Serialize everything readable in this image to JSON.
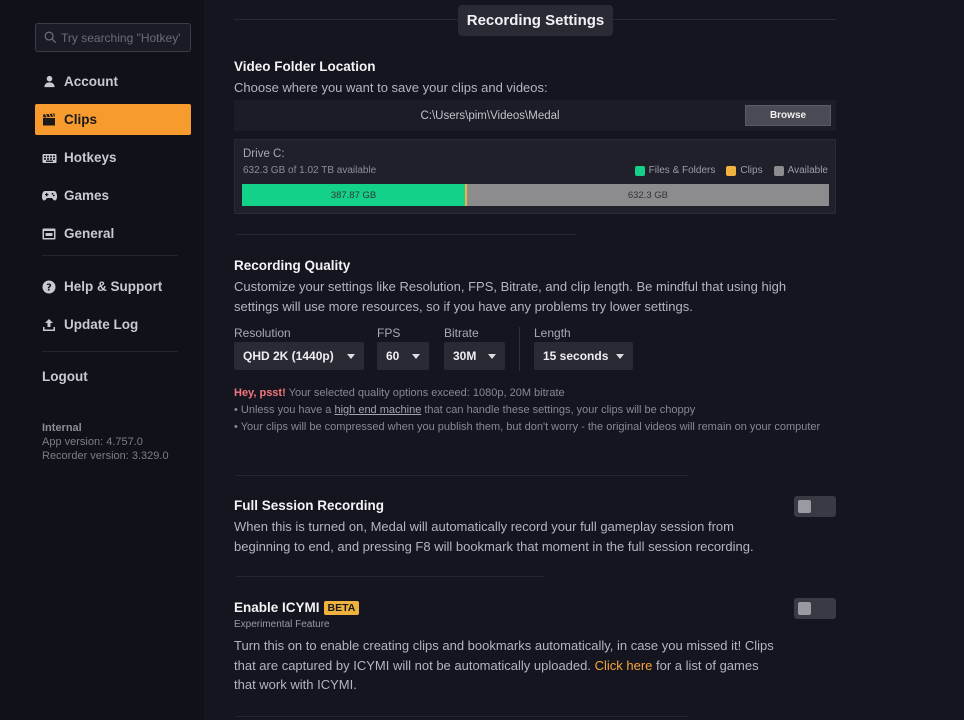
{
  "sidebar": {
    "search_placeholder": "Try searching \"Hotkey\"",
    "items": [
      {
        "label": "Account",
        "icon": "user-icon"
      },
      {
        "label": "Clips",
        "icon": "clapperboard-icon",
        "active": true
      },
      {
        "label": "Hotkeys",
        "icon": "keyboard-icon"
      },
      {
        "label": "Games",
        "icon": "gamepad-icon"
      },
      {
        "label": "General",
        "icon": "window-icon"
      }
    ],
    "support_items": [
      {
        "label": "Help & Support",
        "icon": "help-circle-icon"
      },
      {
        "label": "Update Log",
        "icon": "upload-icon"
      }
    ],
    "logout": "Logout",
    "build": "Internal",
    "app_version": "App version: 4.757.0",
    "recorder_version": "Recorder version: 3.329.0"
  },
  "colors": {
    "accent": "#f89b2e",
    "files": "#14d18a",
    "clips": "#f0b23e",
    "available": "#8c8c8f",
    "warning": "#f4777e"
  },
  "page": {
    "title": "Recording Settings"
  },
  "video_folder": {
    "title": "Video Folder Location",
    "description": "Choose where you want to save your clips and videos:",
    "path": "C:\\Users\\pim\\Videos\\Medal",
    "browse_label": "Browse",
    "drive_label": "Drive C:",
    "drive_summary": "632.3 GB of 1.02 TB available",
    "legend": {
      "files": "Files & Folders",
      "clips": "Clips",
      "available": "Available"
    },
    "files_label": "387.87 GB",
    "available_label": "632.3 GB",
    "files_fraction": 0.38,
    "clips_fraction": 0.003
  },
  "quality": {
    "title": "Recording Quality",
    "description": "Customize your settings like Resolution, FPS, Bitrate, and clip length. Be mindful that using high settings will use more resources, so if you have any problems try lower settings.",
    "resolution_label": "Resolution",
    "resolution_value": "QHD 2K (1440p)",
    "fps_label": "FPS",
    "fps_value": "60",
    "bitrate_label": "Bitrate",
    "bitrate_value": "30M",
    "length_label": "Length",
    "length_value": "15 seconds",
    "warn_prefix": "Hey, psst!",
    "warn_text": " Your selected quality options exceed: 1080p, 20M bitrate",
    "bullet1_a": "• Unless you have a ",
    "bullet1_link": "high end machine",
    "bullet1_b": " that can handle these settings, your clips will be choppy",
    "bullet2": "• Your clips will be compressed when you publish them, but don't worry - the original videos will remain on your computer"
  },
  "full_session": {
    "title": "Full Session Recording",
    "description": "When this is turned on, Medal will automatically record your full gameplay session from beginning to end, and pressing F8 will bookmark that moment in the full session recording.",
    "enabled": false
  },
  "icymi": {
    "title": "Enable ICYMI",
    "badge": "BETA",
    "subtitle": "Experimental Feature",
    "desc_a": "Turn this on to enable creating clips and bookmarks automatically, in case you missed it! Clips that are captured by ICYMI will not be automatically uploaded. ",
    "link": "Click here",
    "desc_b": " for a list of games that work with ICYMI.",
    "enabled": false
  }
}
